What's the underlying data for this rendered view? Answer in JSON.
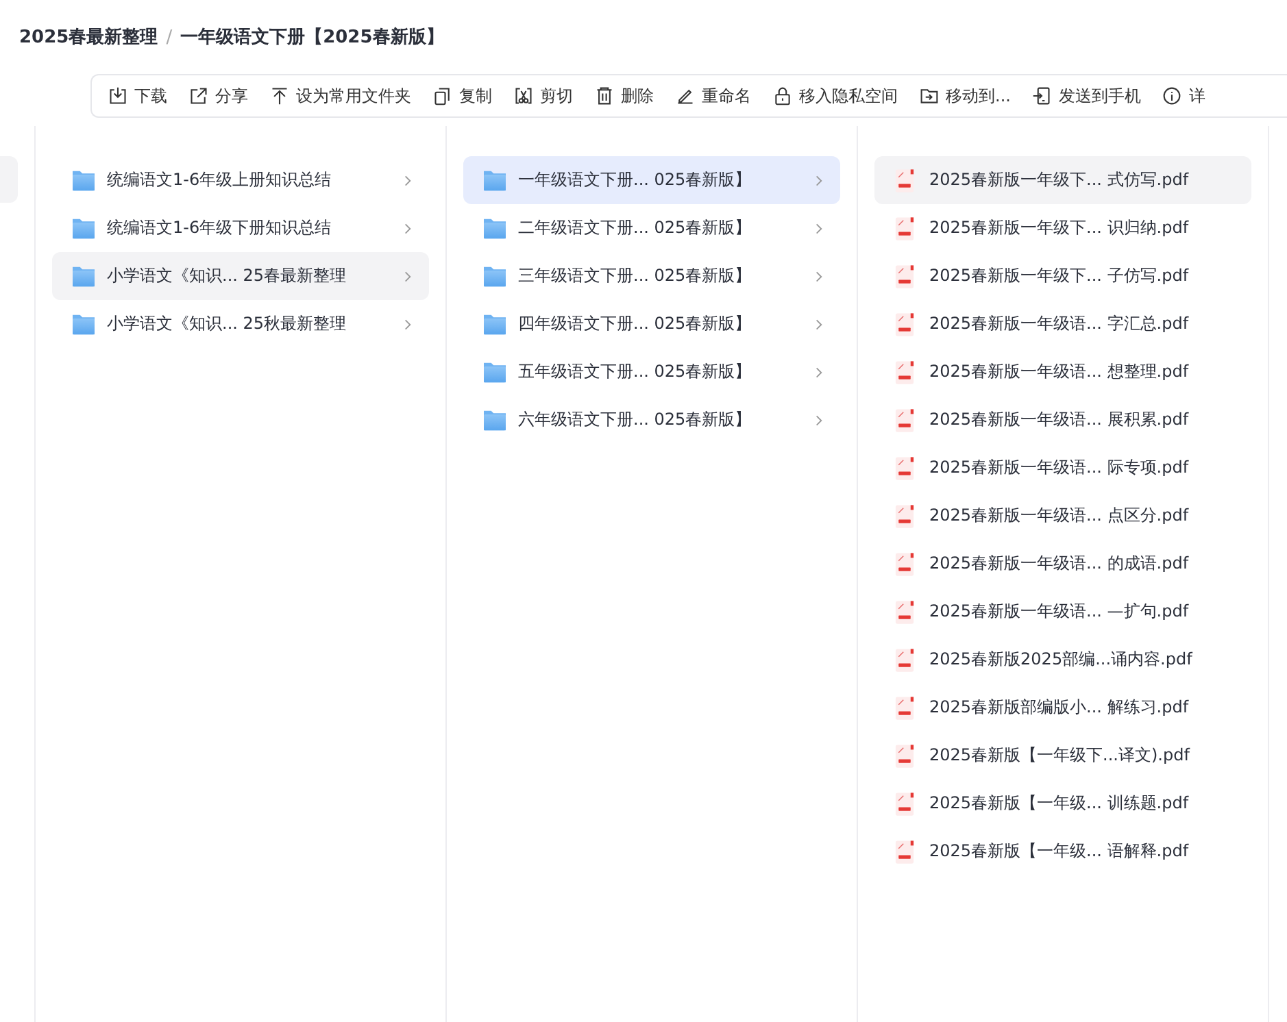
{
  "breadcrumb": [
    {
      "label": "2025春最新整理"
    },
    {
      "label": "一年级语文下册【2025春新版】"
    }
  ],
  "breadcrumb_separator": "/",
  "toolbar": [
    {
      "kind": "download",
      "label": "下载"
    },
    {
      "kind": "share",
      "label": "分享"
    },
    {
      "kind": "pin",
      "label": "设为常用文件夹"
    },
    {
      "kind": "copy",
      "label": "复制"
    },
    {
      "kind": "cut",
      "label": "剪切"
    },
    {
      "kind": "delete",
      "label": "删除"
    },
    {
      "kind": "rename",
      "label": "重命名"
    },
    {
      "kind": "lock",
      "label": "移入隐私空间"
    },
    {
      "kind": "move",
      "label": "移动到..."
    },
    {
      "kind": "send",
      "label": "发送到手机"
    },
    {
      "kind": "info",
      "label": "详"
    }
  ],
  "columns": [
    {
      "focused": false,
      "items": [
        {
          "kind": "folder",
          "name": "统编语文1-6年级上册知识总结",
          "selected": false
        },
        {
          "kind": "folder",
          "name": "统编语文1-6年级下册知识总结",
          "selected": false
        },
        {
          "kind": "folder",
          "name": "小学语文《知识... 25春最新整理",
          "selected": true
        },
        {
          "kind": "folder",
          "name": "小学语文《知识... 25秋最新整理",
          "selected": false
        }
      ]
    },
    {
      "focused": true,
      "items": [
        {
          "kind": "folder",
          "name": "一年级语文下册... 025春新版】",
          "selected": true
        },
        {
          "kind": "folder",
          "name": "二年级语文下册... 025春新版】",
          "selected": false
        },
        {
          "kind": "folder",
          "name": "三年级语文下册... 025春新版】",
          "selected": false
        },
        {
          "kind": "folder",
          "name": "四年级语文下册... 025春新版】",
          "selected": false
        },
        {
          "kind": "folder",
          "name": "五年级语文下册... 025春新版】",
          "selected": false
        },
        {
          "kind": "folder",
          "name": "六年级语文下册... 025春新版】",
          "selected": false
        }
      ]
    },
    {
      "focused": false,
      "items": [
        {
          "kind": "pdf",
          "name": "2025春新版一年级下... 式仿写.pdf",
          "selected": true
        },
        {
          "kind": "pdf",
          "name": "2025春新版一年级下... 识归纳.pdf",
          "selected": false
        },
        {
          "kind": "pdf",
          "name": "2025春新版一年级下... 子仿写.pdf",
          "selected": false
        },
        {
          "kind": "pdf",
          "name": "2025春新版一年级语... 字汇总.pdf",
          "selected": false
        },
        {
          "kind": "pdf",
          "name": "2025春新版一年级语... 想整理.pdf",
          "selected": false
        },
        {
          "kind": "pdf",
          "name": "2025春新版一年级语... 展积累.pdf",
          "selected": false
        },
        {
          "kind": "pdf",
          "name": "2025春新版一年级语... 际专项.pdf",
          "selected": false
        },
        {
          "kind": "pdf",
          "name": "2025春新版一年级语... 点区分.pdf",
          "selected": false
        },
        {
          "kind": "pdf",
          "name": "2025春新版一年级语... 的成语.pdf",
          "selected": false
        },
        {
          "kind": "pdf",
          "name": "2025春新版一年级语... —扩句.pdf",
          "selected": false
        },
        {
          "kind": "pdf",
          "name": "2025春新版2025部编...诵内容.pdf",
          "selected": false
        },
        {
          "kind": "pdf",
          "name": "2025春新版部编版小... 解练习.pdf",
          "selected": false
        },
        {
          "kind": "pdf",
          "name": "2025春新版【一年级下...译文).pdf",
          "selected": false
        },
        {
          "kind": "pdf",
          "name": "2025春新版【一年级... 训练题.pdf",
          "selected": false
        },
        {
          "kind": "pdf",
          "name": "2025春新版【一年级... 语解释.pdf",
          "selected": false
        }
      ]
    }
  ]
}
